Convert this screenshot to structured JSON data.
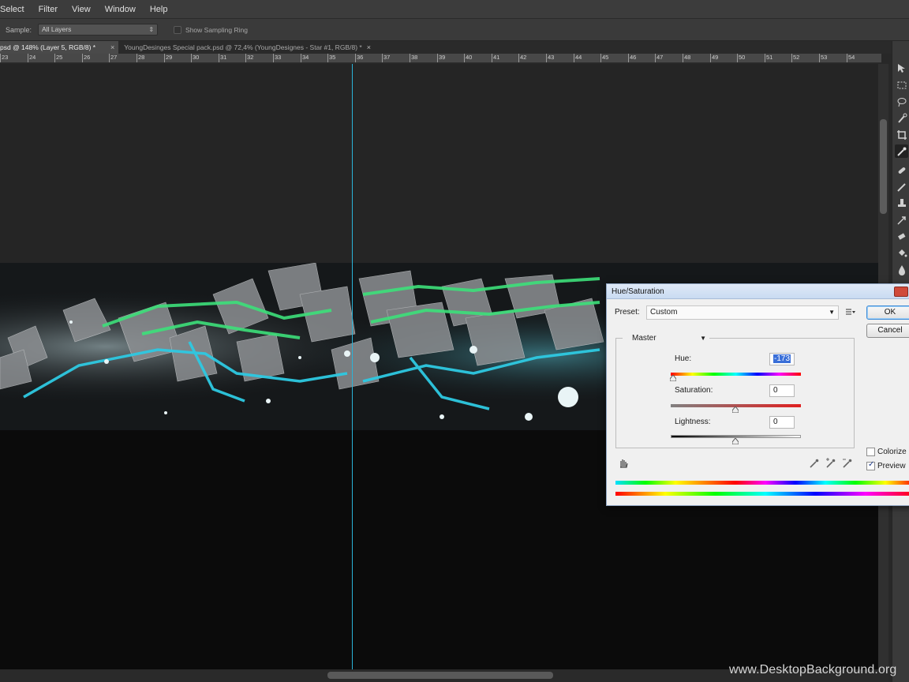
{
  "menubar": {
    "items": [
      "Select",
      "Filter",
      "View",
      "Window",
      "Help"
    ]
  },
  "options": {
    "sample_label": "Sample:",
    "sample_value": "All Layers",
    "show_sampling_ring": "Show Sampling Ring"
  },
  "tabs": [
    {
      "label": "psd @ 148% (Layer 5, RGB/8) *",
      "active": true
    },
    {
      "label": "YoungDesinges Special pack.psd @ 72,4% (YoungDesignes - Star #1, RGB/8) *",
      "active": false
    }
  ],
  "ruler": {
    "labels": [
      "23",
      "24",
      "25",
      "26",
      "27",
      "28",
      "29",
      "30",
      "31",
      "32",
      "33",
      "34",
      "35",
      "36",
      "37",
      "38",
      "39",
      "40",
      "41",
      "42",
      "43",
      "44",
      "45",
      "46",
      "47",
      "48",
      "49",
      "50",
      "51",
      "52",
      "53",
      "54"
    ]
  },
  "dialog": {
    "title": "Hue/Saturation",
    "preset_label": "Preset:",
    "preset_value": "Custom",
    "ok": "OK",
    "cancel": "Cancel",
    "channel": "Master",
    "hue_label": "Hue:",
    "hue_value": "-173",
    "saturation_label": "Saturation:",
    "saturation_value": "0",
    "lightness_label": "Lightness:",
    "lightness_value": "0",
    "colorize_label": "Colorize",
    "colorize_checked": false,
    "preview_label": "Preview",
    "preview_checked": true
  },
  "watermark": "www.DesktopBackground.org"
}
